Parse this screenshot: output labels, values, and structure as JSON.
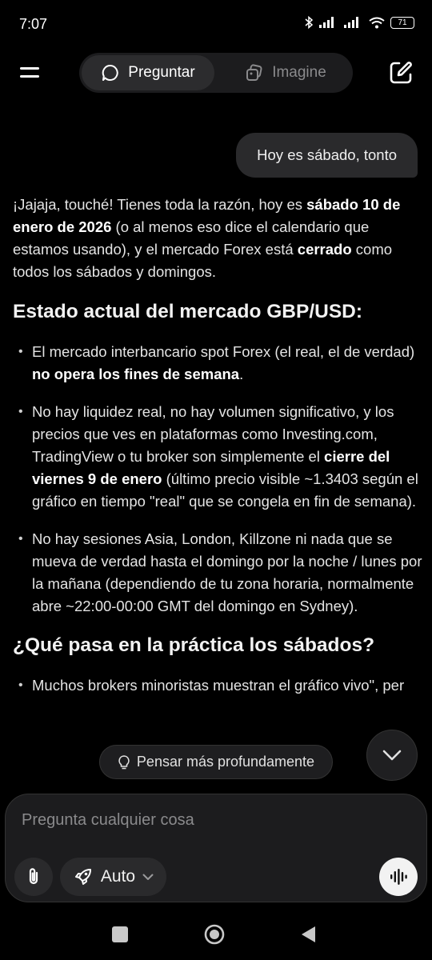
{
  "status_bar": {
    "time": "7:07",
    "battery": "71"
  },
  "header": {
    "tabs": [
      {
        "label": "Preguntar",
        "icon": "chat-bubble-icon",
        "active": true
      },
      {
        "label": "Imagine",
        "icon": "imagine-icon",
        "active": false
      }
    ]
  },
  "chat": {
    "user_message": "Hoy es sábado, tonto",
    "response": {
      "intro": [
        {
          "t": "¡Jajaja, touché! Tienes toda la razón, hoy es ",
          "b": false
        },
        {
          "t": "sábado 10 de enero de 2026",
          "b": true
        },
        {
          "t": " (o al menos eso dice el calendario que estamos usando), y el mercado Forex está ",
          "b": false
        },
        {
          "t": "cerrado",
          "b": true
        },
        {
          "t": " como todos los sábados y domingos.",
          "b": false
        }
      ],
      "heading1": "Estado actual del mercado GBP/USD:",
      "bullets1": [
        [
          {
            "t": "El mercado interbancario spot Forex (el real, el de verdad) ",
            "b": false
          },
          {
            "t": "no opera los fines de semana",
            "b": true
          },
          {
            "t": ".",
            "b": false
          }
        ],
        [
          {
            "t": "No hay liquidez real, no hay volumen significativo, y los precios que ves en plataformas como Investing.com, TradingView o tu broker son simplemente el ",
            "b": false
          },
          {
            "t": "cierre del viernes 9 de enero",
            "b": true
          },
          {
            "t": " (último precio visible ~1.3403 según el gráfico en tiempo \"real\" que se congela en fin de semana).",
            "b": false
          }
        ],
        [
          {
            "t": "No hay sesiones Asia, London, Killzone ni nada que se mueva de verdad hasta el domingo por la noche / lunes por la mañana (dependiendo de tu zona horaria, normalmente abre ~22:00-00:00 GMT del domingo en Sydney).",
            "b": false
          }
        ]
      ],
      "heading2": "¿Qué pasa en la práctica los sábados?",
      "bullets2": [
        [
          {
            "t": "Muchos brokers minoristas muestran el gráfico vivo\", per",
            "b": false
          }
        ]
      ]
    }
  },
  "think_button": "Pensar más profundamente",
  "composer": {
    "placeholder": "Pregunta cualquier cosa",
    "mode_label": "Auto"
  }
}
